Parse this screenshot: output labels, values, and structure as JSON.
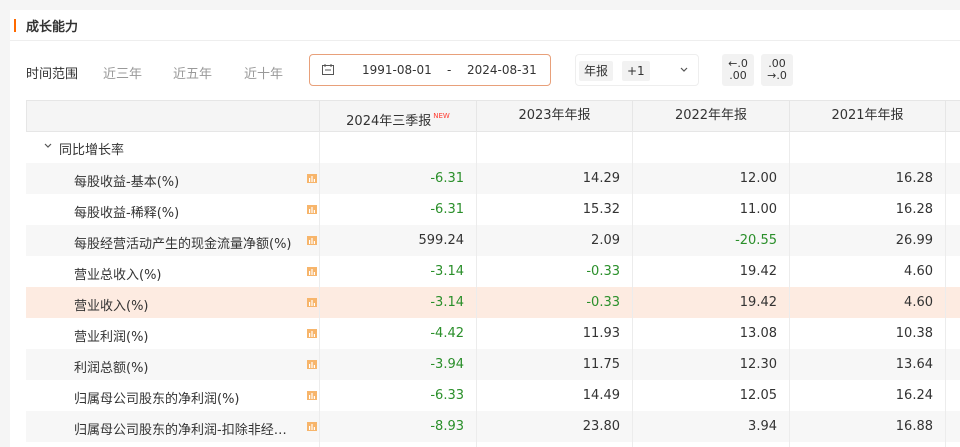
{
  "section": {
    "title": "成长能力"
  },
  "toolbar": {
    "time_label": "时间范围",
    "ranges": [
      "近三年",
      "近五年",
      "近十年"
    ],
    "date_start": "1991-08-01",
    "date_sep": "-",
    "date_end": "2024-08-31",
    "report_type": "年报",
    "report_plus": "+1",
    "dec_less": {
      "l1": "←.0",
      "l2": ".00"
    },
    "dec_more": {
      "l1": ".00",
      "l2": "→.0"
    }
  },
  "table": {
    "columns": [
      "2024年三季报",
      "2023年年报",
      "2022年年报",
      "2021年年报"
    ],
    "new_badge": "NEW",
    "group_label": "同比增长率",
    "rows": [
      {
        "label": "每股收益-基本(%)",
        "values": [
          "-6.31",
          "14.29",
          "12.00",
          "16.28"
        ]
      },
      {
        "label": "每股收益-稀释(%)",
        "values": [
          "-6.31",
          "15.32",
          "11.00",
          "16.28"
        ]
      },
      {
        "label": "每股经营活动产生的现金流量净额(%)",
        "values": [
          "599.24",
          "2.09",
          "-20.55",
          "26.99"
        ]
      },
      {
        "label": "营业总收入(%)",
        "values": [
          "-3.14",
          "-0.33",
          "19.42",
          "4.60"
        ]
      },
      {
        "label": "营业收入(%)",
        "values": [
          "-3.14",
          "-0.33",
          "19.42",
          "4.60"
        ]
      },
      {
        "label": "营业利润(%)",
        "values": [
          "-4.42",
          "11.93",
          "13.08",
          "10.38"
        ]
      },
      {
        "label": "利润总额(%)",
        "values": [
          "-3.94",
          "11.75",
          "12.30",
          "13.64"
        ]
      },
      {
        "label": "归属母公司股东的净利润(%)",
        "values": [
          "-6.33",
          "14.49",
          "12.05",
          "16.24"
        ]
      },
      {
        "label": "归属母公司股东的净利润-扣除非经…",
        "values": [
          "-8.93",
          "23.80",
          "3.94",
          "16.88"
        ]
      }
    ]
  },
  "colors": {
    "accent": "#ff6a00",
    "negative": "#2a8f2a",
    "highlight_row": "#fdebe1"
  }
}
